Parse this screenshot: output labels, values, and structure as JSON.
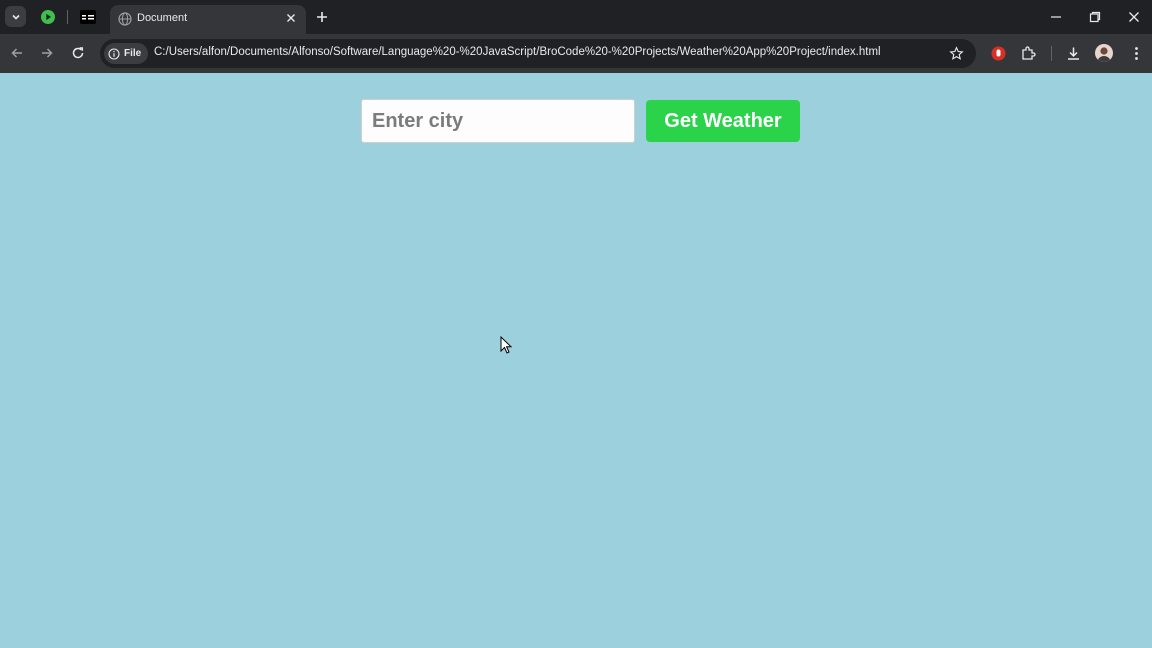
{
  "browser": {
    "tab": {
      "title": "Document"
    },
    "address_bar": {
      "site_info_label": "File",
      "url": "C:/Users/alfon/Documents/Alfonso/Software/Language%20-%20JavaScript/BroCode%20-%20Projects/Weather%20App%20Project/index.html"
    },
    "icons": {
      "tab_search": "chevron-down-icon",
      "pinned_tab_1": "play-circle-icon",
      "pinned_tab_2": "app-icon",
      "tab_favicon": "globe-icon",
      "tab_close": "close-icon",
      "new_tab": "plus-icon",
      "minimize": "minimize-icon",
      "restore": "restore-icon",
      "close_window": "close-icon",
      "back": "back-arrow-icon",
      "forward": "forward-arrow-icon",
      "reload": "reload-icon",
      "info": "info-icon",
      "bookmark": "star-icon",
      "extension_red": "extension-record-icon",
      "extensions": "puzzle-icon",
      "download": "download-icon",
      "profile": "avatar",
      "menu": "kebab-menu-icon"
    }
  },
  "page": {
    "city_input": {
      "placeholder": "Enter city",
      "value": ""
    },
    "submit_button": {
      "label": "Get Weather"
    }
  },
  "colors": {
    "page_background": "#9dd0dd",
    "button_background": "#2bd34b",
    "button_text": "#ffffff",
    "chrome_dark": "#202124",
    "chrome_toolbar": "#35363a"
  }
}
